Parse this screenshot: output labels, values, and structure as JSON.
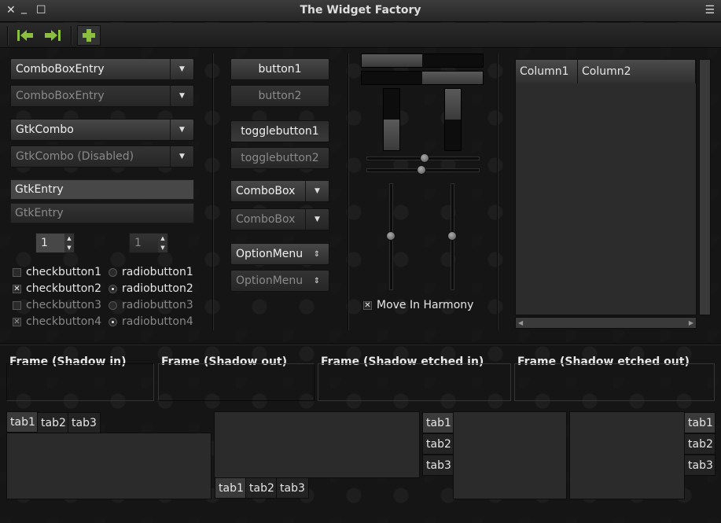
{
  "window": {
    "title": "The Widget Factory"
  },
  "colors": {
    "accent": "#8bbf3e",
    "bg": "#151515"
  },
  "toolbar": {
    "icons": [
      "go-first-icon",
      "go-last-icon",
      "add-icon"
    ]
  },
  "combos": {
    "entry1": "ComboBoxEntry",
    "entry2": "ComboBoxEntry",
    "gtk1": "GtkCombo",
    "gtk2": "GtkCombo (Disabled)",
    "cb1": "ComboBox",
    "cb2": "ComboBox",
    "om1": "OptionMenu",
    "om2": "OptionMenu"
  },
  "entries": {
    "e1": "GtkEntry",
    "e2": "GtkEntry"
  },
  "spins": {
    "s1": "1",
    "s2": "1"
  },
  "checks": [
    "checkbutton1",
    "checkbutton2",
    "checkbutton3",
    "checkbutton4"
  ],
  "radios": [
    "radiobutton1",
    "radiobutton2",
    "radiobutton3",
    "radiobutton4"
  ],
  "buttons": {
    "b1": "button1",
    "b2": "button2",
    "t1": "togglebutton1",
    "t2": "togglebutton2"
  },
  "progress": {
    "h1": 0.5,
    "h2": 0.5,
    "v1": 0.5,
    "v2": 0.5
  },
  "harmony": "Move In Harmony",
  "tree": {
    "columns": [
      "Column1",
      "Column2"
    ]
  },
  "frames": [
    "Frame (Shadow in)",
    "Frame (Shadow out)",
    "Frame (Shadow etched in)",
    "Frame (Shadow etched out)"
  ],
  "tabs": [
    "tab1",
    "tab2",
    "tab3"
  ]
}
